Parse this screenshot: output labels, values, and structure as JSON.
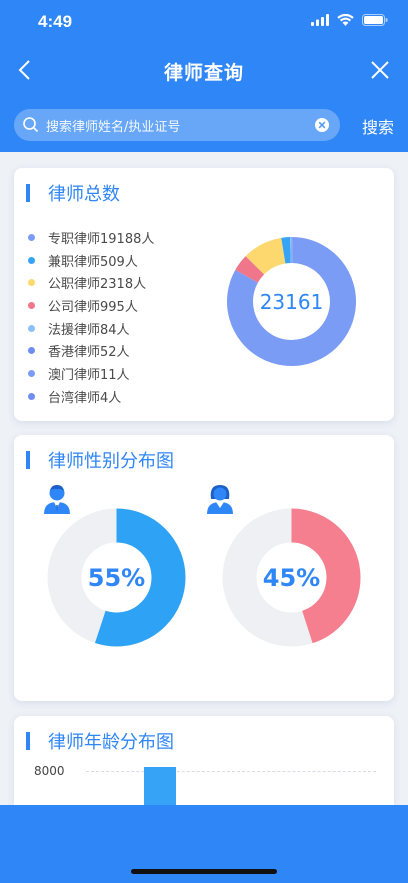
{
  "status_bar": {
    "time": "4:49"
  },
  "nav": {
    "title": "律师查询"
  },
  "search": {
    "placeholder": "搜索律师姓名/执业证号",
    "button_label": "搜索"
  },
  "total_card": {
    "title": "律师总数",
    "total": "23161",
    "items": [
      {
        "label": "专职律师19188人",
        "value": 19188,
        "color": "#7b9cf5"
      },
      {
        "label": "兼职律师509人",
        "value": 509,
        "color": "#36a3f7"
      },
      {
        "label": "公职律师2318人",
        "value": 2318,
        "color": "#fcd86e"
      },
      {
        "label": "公司律师995人",
        "value": 995,
        "color": "#f0778b"
      },
      {
        "label": "法援律师84人",
        "value": 84,
        "color": "#8cc1f8"
      },
      {
        "label": "香港律师52人",
        "value": 52,
        "color": "#6f8ff0"
      },
      {
        "label": "澳门律师11人",
        "value": 11,
        "color": "#7b9cf5"
      },
      {
        "label": "台湾律师4人",
        "value": 4,
        "color": "#6f8ff0"
      }
    ]
  },
  "gender_card": {
    "title": "律师性别分布图",
    "male": {
      "percent_text": "55%",
      "fraction": 0.55,
      "color": "#2ea3f5",
      "track": "#eef0f4",
      "icon": "male-avatar-icon"
    },
    "female": {
      "percent_text": "45%",
      "fraction": 0.45,
      "color": "#f57f8f",
      "track": "#eef0f4",
      "icon": "female-avatar-icon"
    }
  },
  "age_card": {
    "title": "律师年龄分布图",
    "y_tick": "8000"
  },
  "chart_data": [
    {
      "type": "pie",
      "title": "律师总数",
      "categories": [
        "专职律师",
        "兼职律师",
        "公职律师",
        "公司律师",
        "法援律师",
        "香港律师",
        "澳门律师",
        "台湾律师"
      ],
      "values": [
        19188,
        509,
        2318,
        995,
        84,
        52,
        11,
        4
      ],
      "center_label": "23161"
    },
    {
      "type": "pie",
      "title": "律师性别分布图",
      "categories": [
        "男",
        "女"
      ],
      "values": [
        55,
        45
      ]
    },
    {
      "type": "bar",
      "title": "律师年龄分布图",
      "y_ticks": [
        8000
      ],
      "values": [
        8200
      ]
    }
  ]
}
